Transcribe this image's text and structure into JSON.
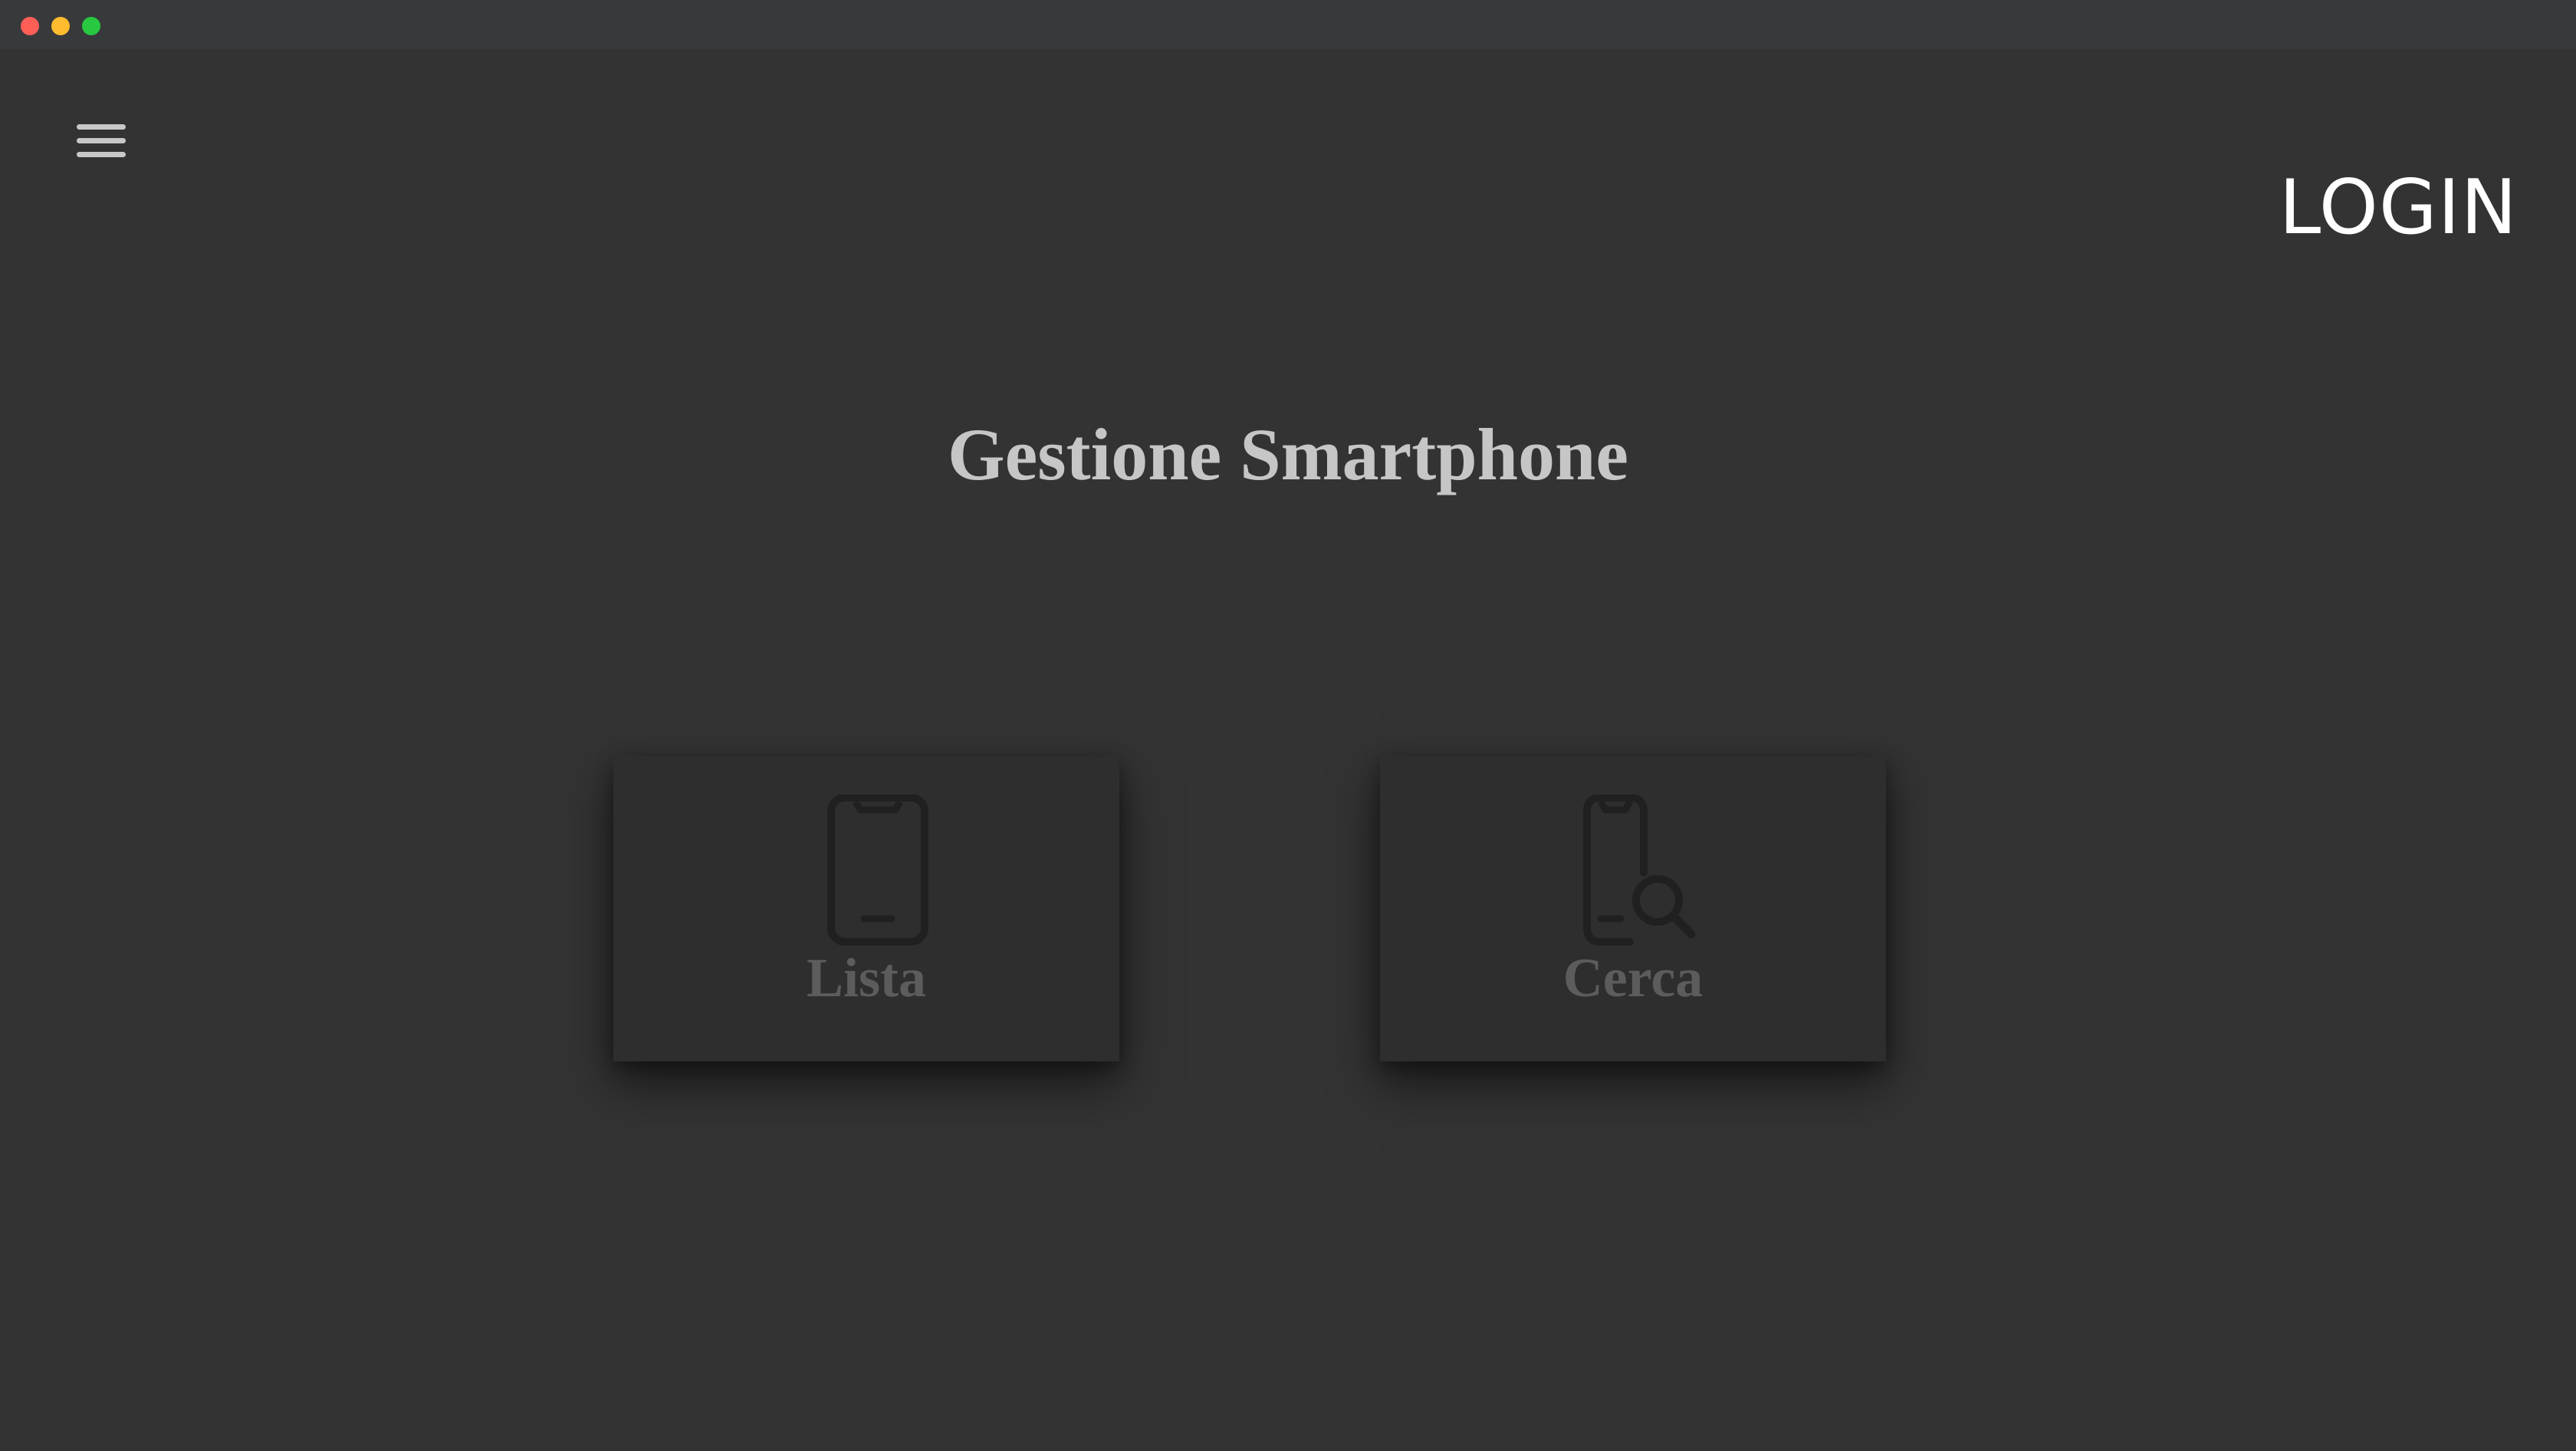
{
  "window": {
    "controls": [
      "close",
      "minimize",
      "maximize"
    ],
    "colors": {
      "background": "#333333",
      "titlebar": "#38393b",
      "close": "#ff5f57",
      "minimize": "#febc2e",
      "maximize": "#28c840"
    }
  },
  "header": {
    "menu_icon": "hamburger-menu-icon",
    "login_label": "LOGIN"
  },
  "main": {
    "title": "Gestione Smartphone",
    "cards": [
      {
        "label": "Lista",
        "icon": "smartphone-icon"
      },
      {
        "label": "Cerca",
        "icon": "smartphone-search-icon"
      }
    ]
  },
  "colors": {
    "title_text": "#c6c6c6",
    "card_background": "#2e2e2e",
    "card_text": "#5c5c5c",
    "card_icon": "#202020",
    "menu_icon": "#c8c8c8",
    "login_text": "#ffffff"
  }
}
